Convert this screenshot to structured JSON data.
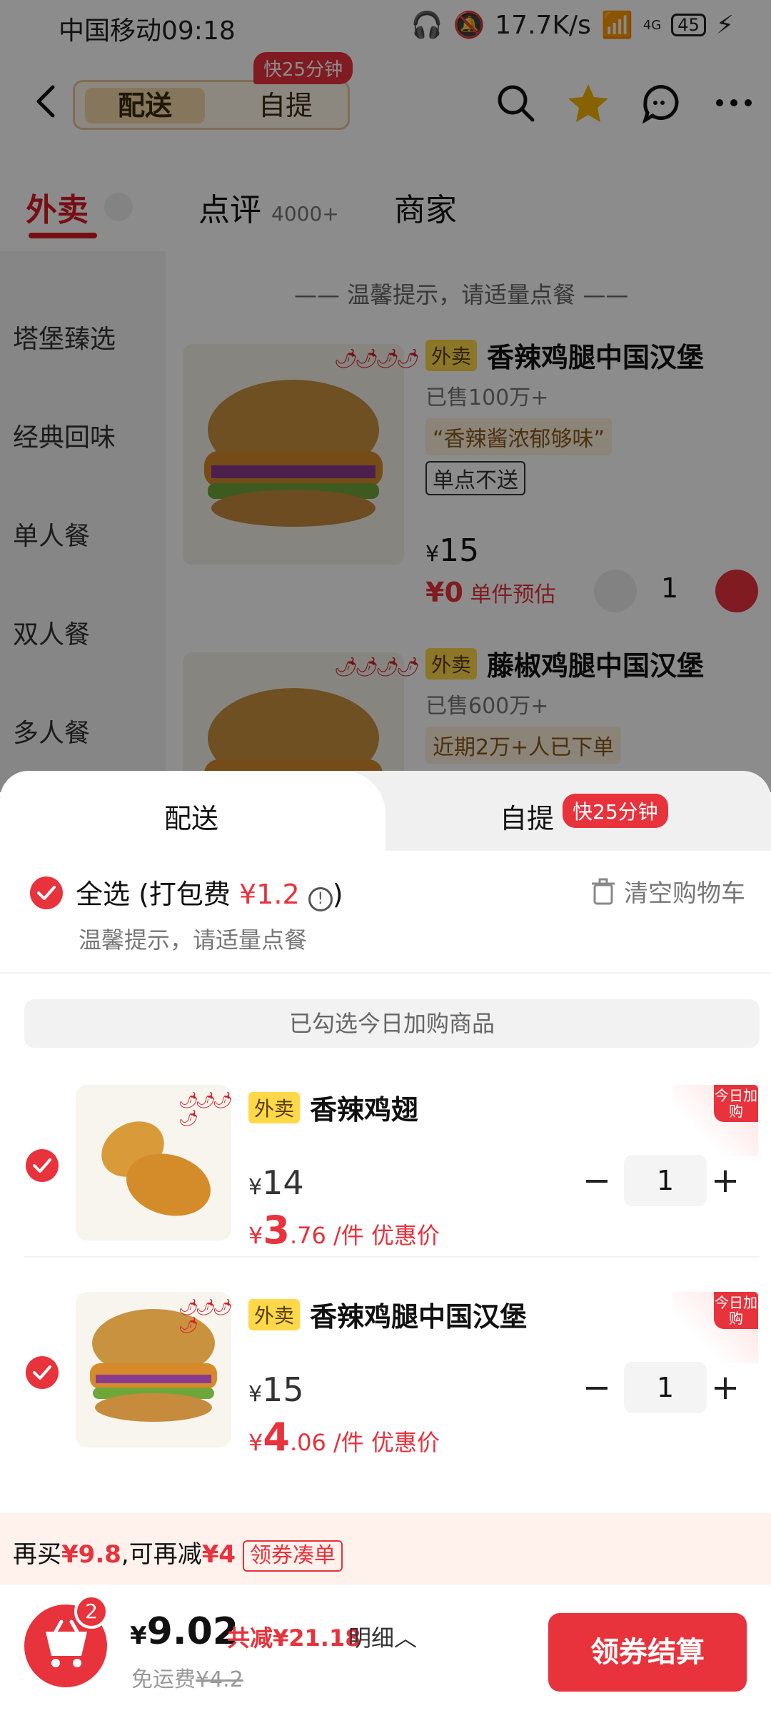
{
  "status_bar": {
    "carrier_time": "中国移动09:18",
    "net_speed": "17.7K/s",
    "network": "4G",
    "battery": "45"
  },
  "header": {
    "mode_delivery": "配送",
    "mode_pickup": "自提",
    "fast_badge": "快25分钟"
  },
  "tabs": {
    "takeout": "外卖",
    "reviews": "点评",
    "reviews_count": "4000+",
    "merchant": "商家"
  },
  "sidebar": {
    "items": [
      "塔堡臻选",
      "经典回味",
      "单人餐",
      "双人餐",
      "多人餐"
    ]
  },
  "notice": "—— 温馨提示，请适量点餐 ——",
  "menu_products": [
    {
      "tag": "外卖",
      "name": "香辣鸡腿中国汉堡",
      "sold": "已售100万+",
      "quote": "“香辣酱浓郁够味”",
      "badge": "单点不送",
      "currency": "¥",
      "price": "15",
      "estimate_amount": "¥0",
      "estimate_label": "单件预估",
      "quantity": "1"
    },
    {
      "tag": "外卖",
      "name": "藤椒鸡腿中国汉堡",
      "sold": "已售600万+",
      "quote": "近期2万+人已下单"
    }
  ],
  "sheet": {
    "tab_delivery": "配送",
    "tab_pickup": "自提",
    "tab_fast_badge": "快25分钟",
    "select_all": "全选",
    "packing_label_open": "(打包费",
    "packing_fee": "¥1.2",
    "packing_label_close": ")",
    "tip": "温馨提示，请适量点餐",
    "clear_cart": "清空购物车",
    "checked_banner": "已勾选今日加购商品",
    "cart_items": [
      {
        "tag": "外卖",
        "name": "香辣鸡翅",
        "currency": "¥",
        "orig_price": "14",
        "deal_currency": "¥",
        "deal_big": "3",
        "deal_small": ".76",
        "deal_unit": " /件 优惠价",
        "quantity": "1",
        "today_badge": "今日加购"
      },
      {
        "tag": "外卖",
        "name": "香辣鸡腿中国汉堡",
        "currency": "¥",
        "orig_price": "15",
        "deal_currency": "¥",
        "deal_big": "4",
        "deal_small": ".06",
        "deal_unit": " /件 优惠价",
        "quantity": "1",
        "today_badge": "今日加购"
      }
    ],
    "promo": {
      "prefix": "再买",
      "amount": "¥9.8",
      "middle": ",可再减",
      "discount": "¥4",
      "button": "领券凑单"
    },
    "checkout": {
      "cart_count": "2",
      "currency": "¥",
      "total": "9.02",
      "saved": "共减¥21.18",
      "detail": "明细︿",
      "shipping_label": "免运费",
      "shipping_orig": "¥4.2",
      "pay_button": "领券结算"
    }
  },
  "colors": {
    "accent_red": "#e8323c",
    "tag_yellow": "#ffd84a"
  }
}
